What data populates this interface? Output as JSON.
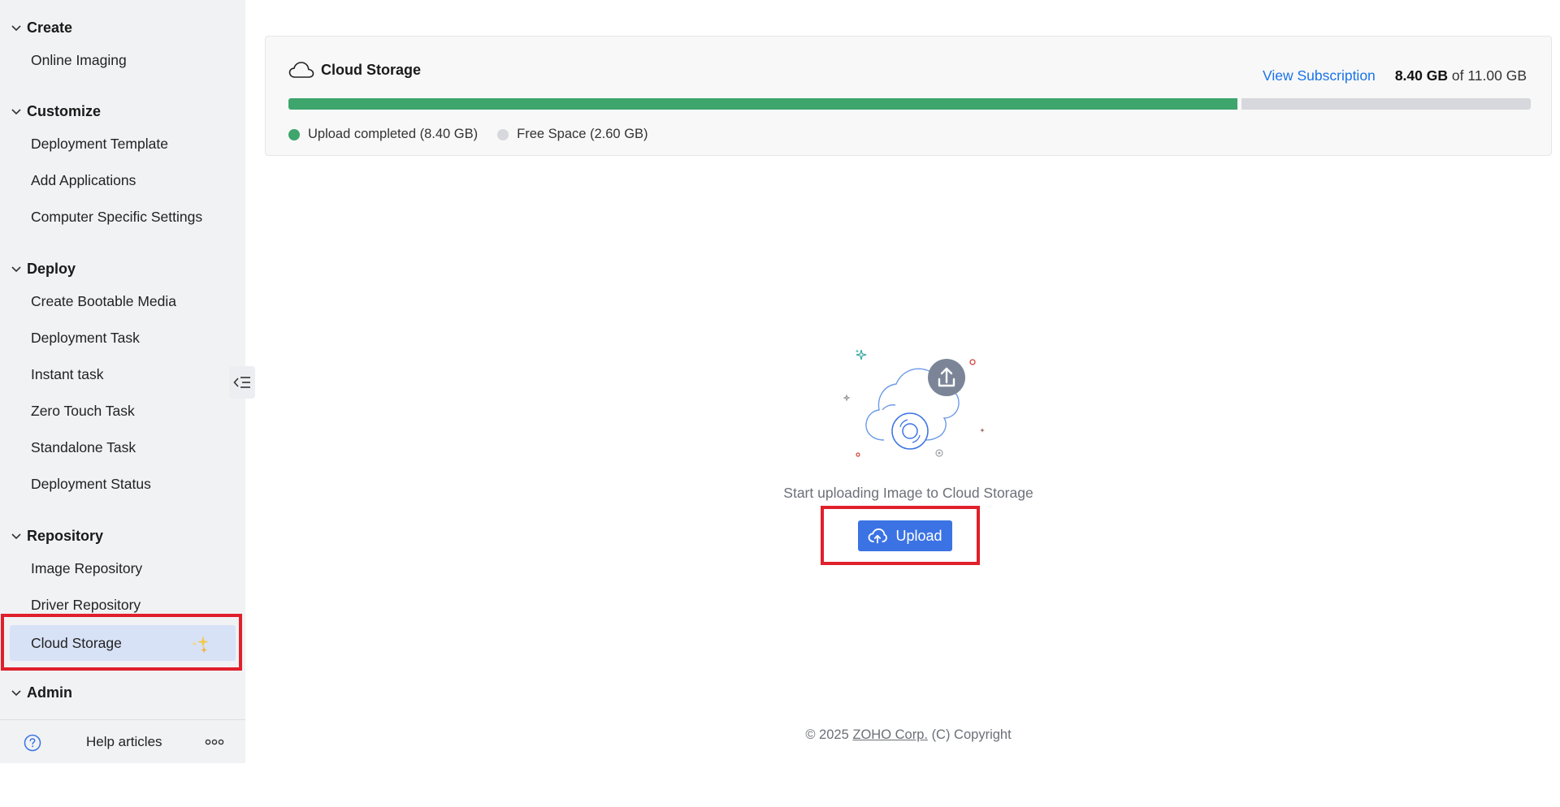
{
  "sidebar": {
    "sections": {
      "create": {
        "title": "Create",
        "items": [
          "Online Imaging"
        ]
      },
      "customize": {
        "title": "Customize",
        "items": [
          "Deployment Template",
          "Add Applications",
          "Computer Specific Settings"
        ]
      },
      "deploy": {
        "title": "Deploy",
        "items": [
          "Create Bootable Media",
          "Deployment Task",
          "Instant task",
          "Zero Touch Task",
          "Standalone Task",
          "Deployment Status"
        ]
      },
      "repository": {
        "title": "Repository",
        "items": [
          "Image Repository",
          "Driver Repository",
          "Cloud Storage"
        ]
      },
      "admin": {
        "title": "Admin"
      }
    },
    "active_item": "Cloud Storage",
    "footer": {
      "help_label": "Help articles",
      "help_icon": "question-circle-icon",
      "more_icon": "more-horizontal-icon"
    },
    "collapse_icon": "collapse-menu-icon"
  },
  "storage": {
    "title": "Cloud Storage",
    "icon": "cloud-icon",
    "view_subscription": "View Subscription",
    "used_value": "8.40 GB",
    "of_text": "of",
    "total_value": "11.00 GB",
    "used_fraction": 0.7636,
    "legend": {
      "used_label": "Upload completed (8.40 GB)",
      "free_label": "Free Space (2.60 GB)"
    },
    "colors": {
      "used": "#3ea56d",
      "free": "#d7d8dd"
    }
  },
  "empty_state": {
    "message": "Start uploading Image to Cloud Storage",
    "upload_label": "Upload",
    "upload_icon": "cloud-upload-icon"
  },
  "footer": {
    "copyright_prefix": "© 2025",
    "company_link": "ZOHO Corp.",
    "copyright_suffix": "(C) Copyright"
  },
  "colors": {
    "accent": "#3b73e4",
    "link": "#1a73e8",
    "highlight": "#e0202a",
    "active_bg": "#d8e2f6"
  }
}
